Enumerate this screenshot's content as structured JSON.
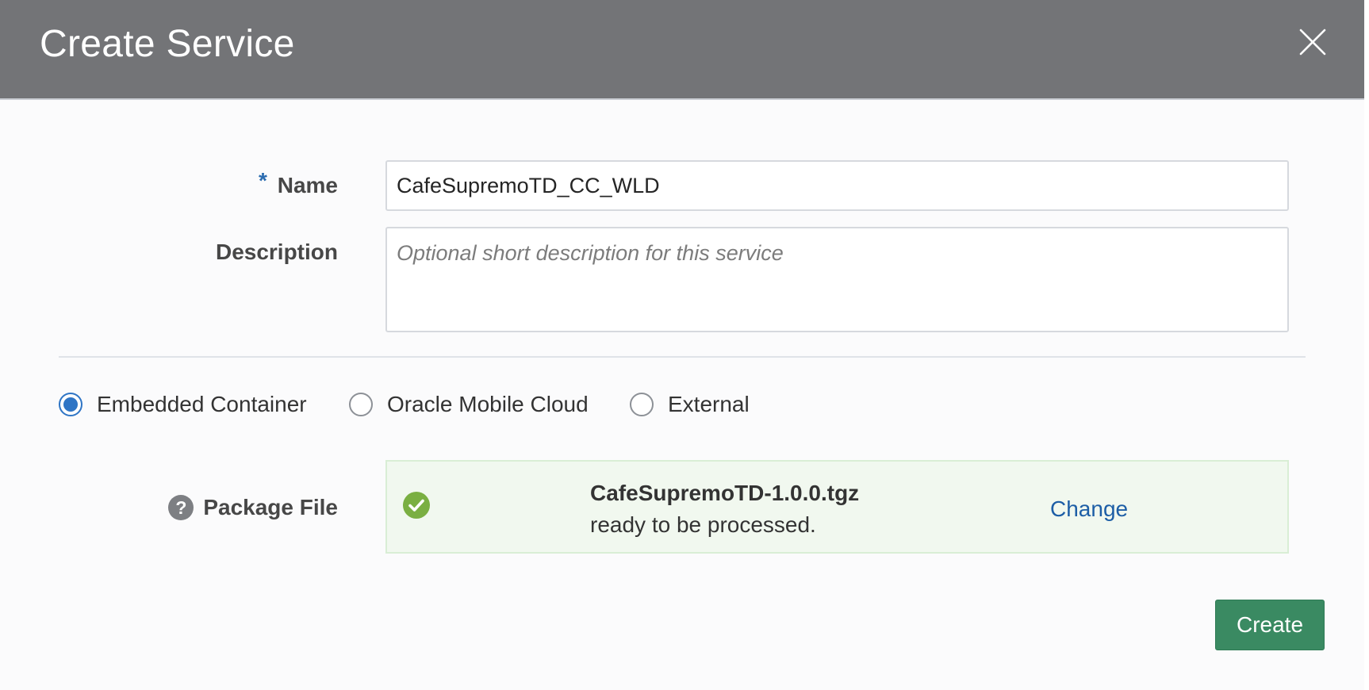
{
  "dialog": {
    "title": "Create Service",
    "close_icon": "close-icon"
  },
  "form": {
    "name_required_marker": "*",
    "name_label": "Name",
    "name_value": "CafeSupremoTD_CC_WLD",
    "description_label": "Description",
    "description_placeholder": "Optional short description for this service",
    "description_value": ""
  },
  "service_type": {
    "selected": "Embedded Container",
    "options": [
      {
        "label": "Embedded Container",
        "selected": true
      },
      {
        "label": "Oracle Mobile Cloud",
        "selected": false
      },
      {
        "label": "External",
        "selected": false
      }
    ]
  },
  "package": {
    "label": "Package File",
    "help_icon": "help-icon",
    "help_glyph": "?",
    "status_icon": "check-circle-icon",
    "filename": "CafeSupremoTD-1.0.0.tgz",
    "status_text": "ready to be processed.",
    "change_label": "Change"
  },
  "actions": {
    "create_label": "Create"
  },
  "colors": {
    "header_bg": "#737477",
    "accent_blue": "#2f75c5",
    "link_blue": "#1d5ea6",
    "success_green": "#7aaf42",
    "success_bg": "#f1f8ef",
    "primary_button": "#3a8a62"
  }
}
